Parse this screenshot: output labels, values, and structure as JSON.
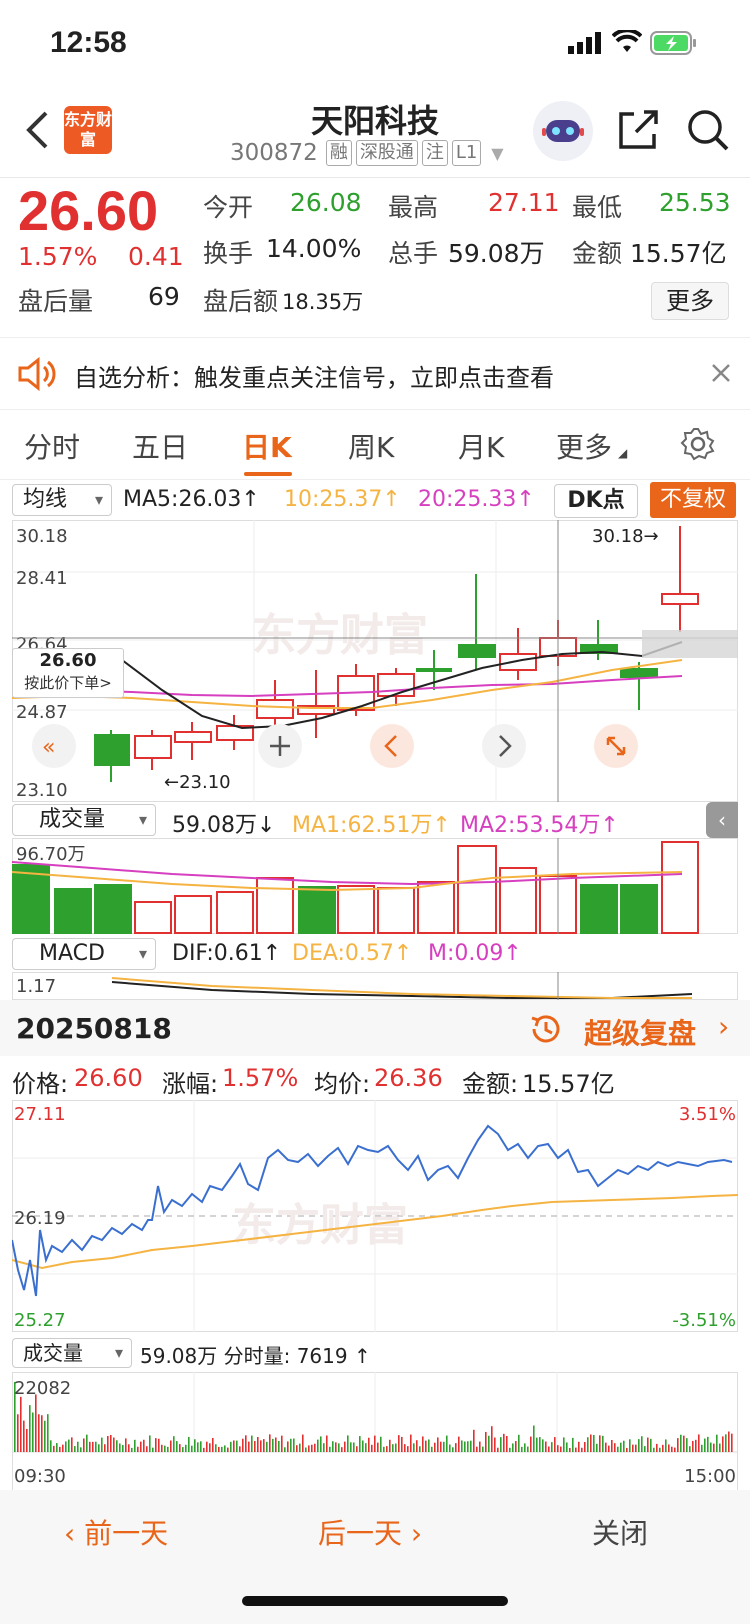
{
  "status": {
    "time": "12:58"
  },
  "header": {
    "logo_text": "东方财富",
    "name": "天阳科技",
    "code": "300872",
    "tags": [
      "融",
      "深股通",
      "注",
      "L1"
    ]
  },
  "quote": {
    "price": "26.60",
    "change_pct": "1.57%",
    "change_amt": "0.41",
    "after_vol_label": "盘后量",
    "after_vol": "69",
    "open_label": "今开",
    "open": "26.08",
    "high_label": "最高",
    "high": "27.11",
    "low_label": "最低",
    "low": "25.53",
    "turnover_label": "换手",
    "turnover": "14.00%",
    "vol_label": "总手",
    "vol": "59.08万",
    "amount_label": "金额",
    "amount": "15.57亿",
    "after_amt_label": "盘后额",
    "after_amt": "18.35万",
    "more": "更多"
  },
  "notice": {
    "text": "自选分析：触发重点关注信号，立即点击查看"
  },
  "tabs": [
    "分时",
    "五日",
    "日K",
    "周K",
    "月K",
    "更多"
  ],
  "active_tab": "日K",
  "kline": {
    "ma_select": "均线",
    "ma5": "MA5:26.03↑",
    "ma10": "10:25.37↑",
    "ma20": "20:25.33↑",
    "dk_btn": "DK点",
    "fq_btn": "不复权",
    "y_labels": [
      "30.18",
      "28.41",
      "26.64",
      "24.87",
      "23.10"
    ],
    "max_mark": "30.18→",
    "min_mark": "←23.10",
    "cursor_price": "26.60",
    "cursor_hint": "按此价下单>",
    "colors": {
      "up": "#e03030",
      "down": "#2ea02e",
      "ma5": "#222222",
      "ma10": "#f5b342",
      "ma20": "#d63fbf"
    }
  },
  "volume": {
    "select": "成交量",
    "vol": "59.08万↓",
    "ma1": "MA1:62.51万↑",
    "ma2": "MA2:53.54万↑",
    "max": "96.70万"
  },
  "macd": {
    "select": "MACD",
    "dif": "DIF:0.61↑",
    "dea": "DEA:0.57↑",
    "m": "M:0.09↑",
    "max": "1.17"
  },
  "intraday": {
    "date": "20250818",
    "replay": "超级复盘",
    "price_label": "价格:",
    "price": "26.60",
    "chg_label": "涨幅:",
    "chg": "1.57%",
    "avg_label": "均价:",
    "avg": "26.36",
    "amt_label": "金额:",
    "amt": "15.57亿",
    "top": "27.11",
    "mid": "26.19",
    "bottom": "25.27",
    "top_pct": "3.51%",
    "bottom_pct": "-3.51%",
    "vol_select": "成交量",
    "vol_text": "59.08万 分时量: 7619 ↑",
    "vol_max": "22082",
    "t_start": "09:30",
    "t_end": "15:00"
  },
  "footer": {
    "prev": "前一天",
    "next": "后一天",
    "close": "关闭"
  }
}
